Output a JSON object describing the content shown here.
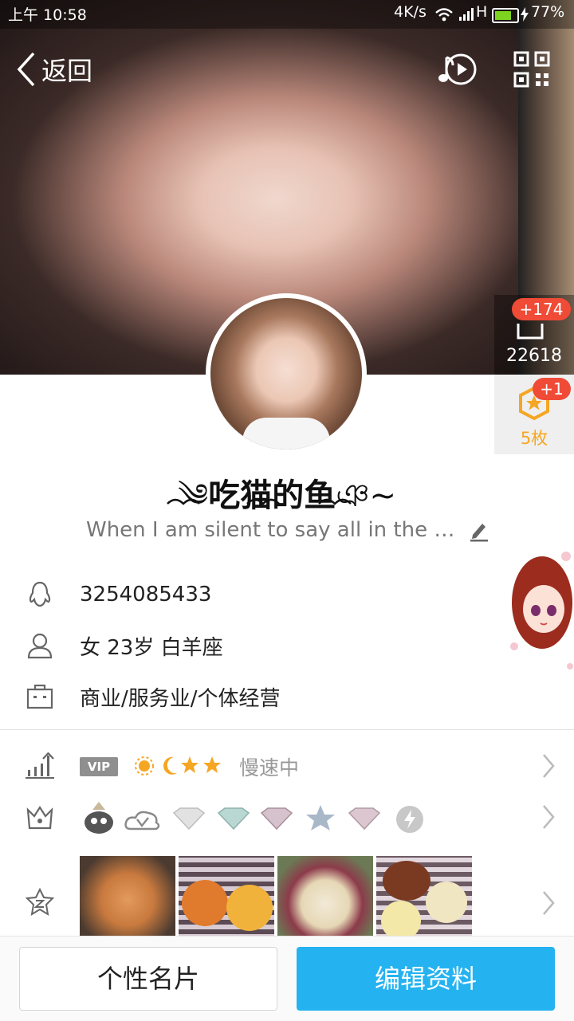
{
  "status_bar": {
    "time": "上午 10:58",
    "network_speed": "4K/s",
    "network_type": "H",
    "battery": "77%",
    "battery_fraction": 0.77
  },
  "nav": {
    "back_label": "返回"
  },
  "likes": {
    "increment": "+174",
    "count": "22618"
  },
  "medals": {
    "increment": "+1",
    "count": "5枚"
  },
  "profile": {
    "nickname": "吃猫的鱼",
    "bio": "When I am silent to say all in the e···"
  },
  "info": {
    "qq": "3254085433",
    "gender_age": "女  23岁  白羊座",
    "occupation": "商业/服务业/个体经营"
  },
  "vip": {
    "tag": "VIP",
    "status": "慢速中"
  },
  "actions": {
    "card": "个性名片",
    "edit": "编辑资料"
  },
  "colors": {
    "accent": "#24b3f0",
    "badge": "#f04b37",
    "medal": "#f5a623"
  }
}
